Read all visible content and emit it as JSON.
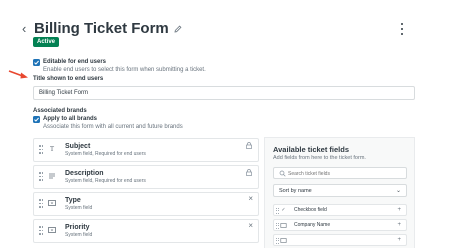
{
  "header": {
    "title": "Billing Ticket Form",
    "status_badge": "Active"
  },
  "form": {
    "editable_label": "Editable for end users",
    "editable_hint": "Enable end users to select this form when submitting a ticket.",
    "title_label": "Title shown to end users",
    "title_value": "Billing Ticket Form",
    "brands_label": "Associated brands",
    "apply_label": "Apply to all brands",
    "apply_hint": "Associate this form with all current and future brands"
  },
  "fields": [
    {
      "name": "Subject",
      "sub": "System field, Required for end users",
      "type_icon": "text-T-icon",
      "action": "lock"
    },
    {
      "name": "Description",
      "sub": "System field, Required for end users",
      "type_icon": "multiline-icon",
      "action": "lock"
    },
    {
      "name": "Type",
      "sub": "System field",
      "type_icon": "dropdown-icon",
      "action": "remove"
    },
    {
      "name": "Priority",
      "sub": "System field",
      "type_icon": "dropdown-icon",
      "action": "remove"
    }
  ],
  "panel": {
    "title": "Available ticket fields",
    "subtitle": "Add fields from here to the ticket form.",
    "search_placeholder": "Search ticket fields",
    "sort_label": "Sort by name",
    "items": [
      {
        "label": "Checkbox field",
        "icon": "check-icon"
      },
      {
        "label": "Company Name",
        "icon": "dropdown-icon"
      },
      {
        "label": "",
        "icon": "field-icon"
      }
    ]
  },
  "colors": {
    "accent": "#1f73b7",
    "badge": "#038153",
    "arrow": "#e8472f"
  }
}
